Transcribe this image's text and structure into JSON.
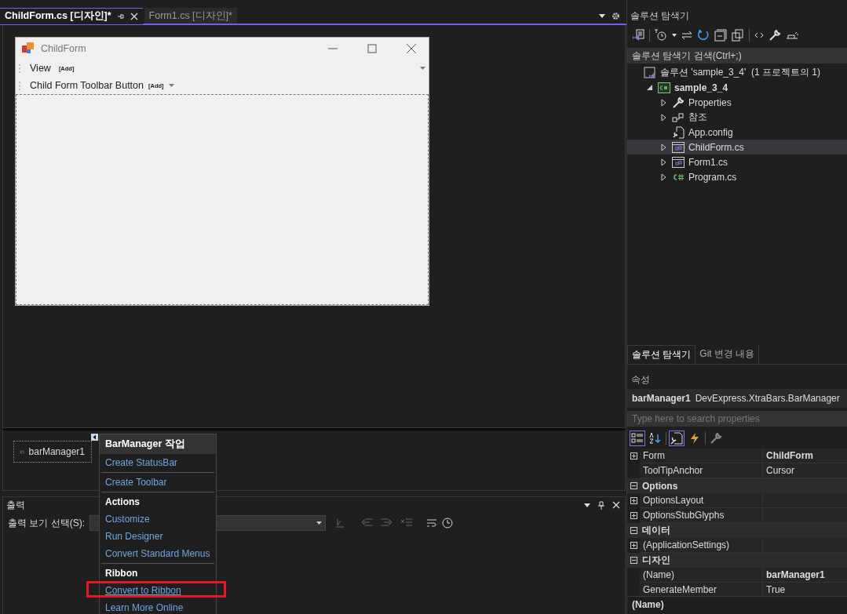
{
  "tabs": [
    {
      "label": "ChildForm.cs [디자인]*",
      "selected": true
    },
    {
      "label": "Form1.cs [디자인]*",
      "selected": false
    }
  ],
  "form": {
    "title": "ChildForm",
    "menu_item": "View",
    "menu_add": "[Add]",
    "toolbar_button": "Child Form Toolbar Button",
    "toolbar_add": "[Add]"
  },
  "component_tray": [
    {
      "label": "barManager1"
    }
  ],
  "smart_tag": {
    "title": "BarManager 작업",
    "groups": [
      {
        "items": [
          {
            "label": "Create StatusBar",
            "marked": false
          }
        ]
      },
      {
        "items": [
          {
            "label": "Create Toolbar",
            "marked": false
          }
        ]
      },
      {
        "header": "Actions",
        "items": [
          {
            "label": "Customize",
            "marked": false
          },
          {
            "label": "Run Designer",
            "marked": false
          },
          {
            "label": "Convert Standard Menus",
            "marked": false
          }
        ]
      },
      {
        "header": "Ribbon",
        "items": [
          {
            "label": "Convert to Ribbon",
            "marked": true
          },
          {
            "label": "Learn More Online",
            "marked": false
          }
        ]
      }
    ]
  },
  "output": {
    "title": "출력",
    "source_label": "출력 보기 선택(S):"
  },
  "solution_explorer": {
    "title": "솔루션 탐색기",
    "search": {
      "placeholder": "솔루션 탐색기 검색(Ctrl+;)"
    },
    "tree": [
      {
        "label": "솔루션 'sample_3_4'  (1 프로젝트의 1)",
        "kind": "solution",
        "selected": false,
        "children": [
          {
            "label": "sample_3_4",
            "kind": "project",
            "expanded": true,
            "selected": false,
            "children": [
              {
                "label": "Properties",
                "kind": "wrench",
                "expanded": false,
                "selected": false
              },
              {
                "label": "참조",
                "kind": "references",
                "expanded": false,
                "selected": false
              },
              {
                "label": "App.config",
                "kind": "config",
                "selected": false
              },
              {
                "label": "ChildForm.cs",
                "kind": "form",
                "expanded": false,
                "selected": true
              },
              {
                "label": "Form1.cs",
                "kind": "form",
                "expanded": false,
                "selected": false
              },
              {
                "label": "Program.cs",
                "kind": "csharp",
                "expanded": false,
                "selected": false
              }
            ]
          }
        ]
      }
    ]
  },
  "bottom_tabs": [
    {
      "label": "솔루션 탐색기",
      "selected": true
    },
    {
      "label": "Git 변경 내용",
      "selected": false
    }
  ],
  "properties": {
    "title": "속성",
    "object_name": "barManager1",
    "object_type": "DevExpress.XtraBars.BarManager",
    "search": {
      "placeholder": "Type here to search properties"
    },
    "toolbar": [
      {
        "kind": "categorized",
        "selected": true
      },
      {
        "kind": "alphabetical",
        "selected": false
      },
      {
        "kind": "properties",
        "selected": true
      },
      {
        "kind": "events",
        "selected": false
      },
      {
        "kind": "pages",
        "selected": false
      }
    ],
    "rows": [
      {
        "kind": "property",
        "name": "Form",
        "value": "ChildForm",
        "expandable": true,
        "modified": true
      },
      {
        "kind": "property",
        "name": "ToolTipAnchor",
        "value": "Cursor",
        "expandable": false,
        "modified": false
      },
      {
        "kind": "category",
        "name": "Options",
        "expanded": true
      },
      {
        "kind": "property",
        "name": "OptionsLayout",
        "expandable": true
      },
      {
        "kind": "property",
        "name": "OptionsStubGlyphs",
        "expandable": true
      },
      {
        "kind": "category",
        "name": "데이터",
        "expanded": true
      },
      {
        "kind": "property",
        "name": "(ApplicationSettings)",
        "expandable": true
      },
      {
        "kind": "category",
        "name": "디자인",
        "expanded": true
      },
      {
        "kind": "property",
        "name": "(Name)",
        "value": "barManager1",
        "expandable": false,
        "modified": true
      },
      {
        "kind": "property",
        "name": "GenerateMember",
        "value": "True",
        "expandable": false,
        "modified": false
      }
    ],
    "description": {
      "name": "(Name)"
    }
  }
}
